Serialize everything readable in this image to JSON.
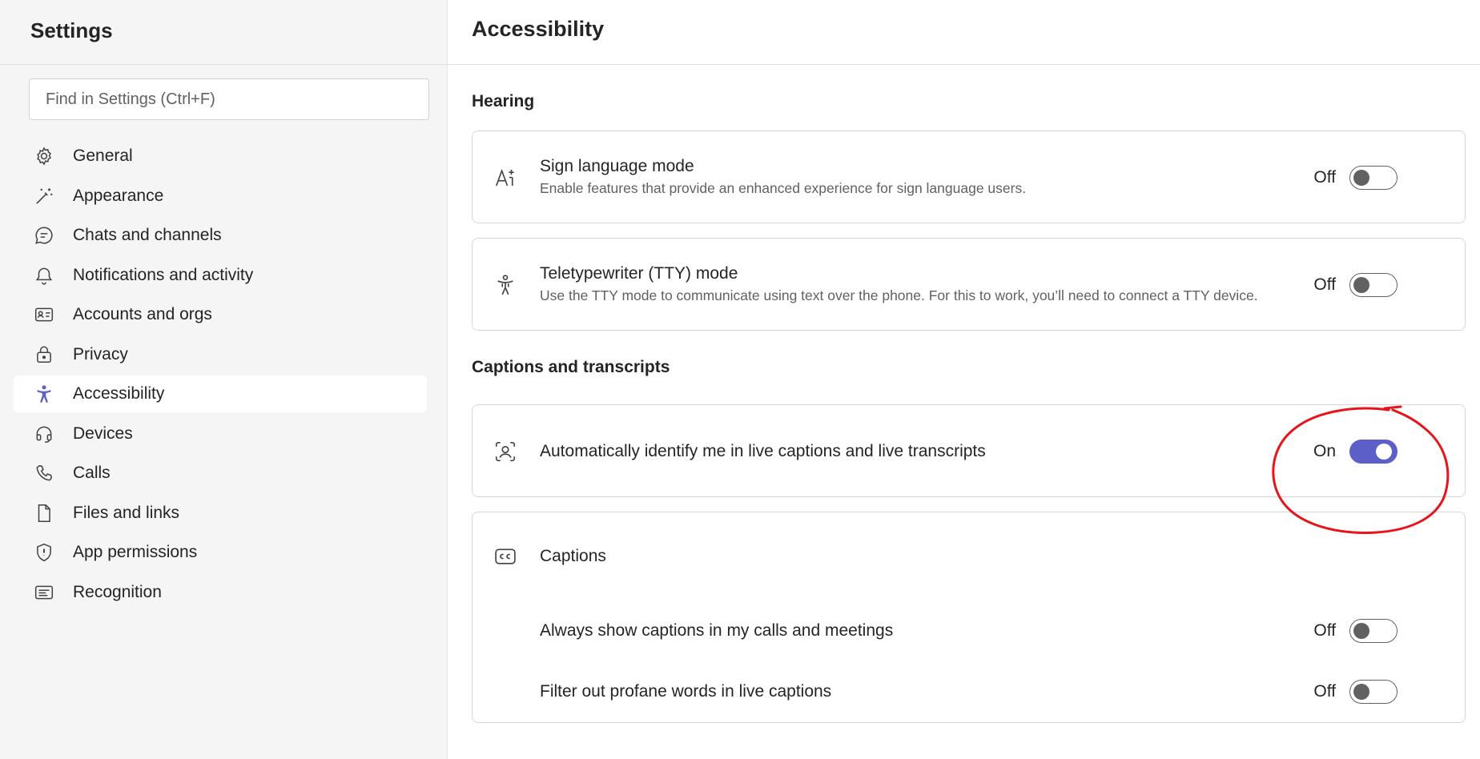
{
  "sidebar": {
    "title": "Settings",
    "search_placeholder": "Find in Settings (Ctrl+F)",
    "items": [
      {
        "label": "General",
        "icon": "gear-icon"
      },
      {
        "label": "Appearance",
        "icon": "magic-wand-icon"
      },
      {
        "label": "Chats and channels",
        "icon": "chat-bubble-icon"
      },
      {
        "label": "Notifications and activity",
        "icon": "bell-icon"
      },
      {
        "label": "Accounts and orgs",
        "icon": "contact-card-icon"
      },
      {
        "label": "Privacy",
        "icon": "lock-icon"
      },
      {
        "label": "Accessibility",
        "icon": "accessibility-icon",
        "active": true
      },
      {
        "label": "Devices",
        "icon": "headset-icon"
      },
      {
        "label": "Calls",
        "icon": "phone-icon"
      },
      {
        "label": "Files and links",
        "icon": "document-icon"
      },
      {
        "label": "App permissions",
        "icon": "shield-icon"
      },
      {
        "label": "Recognition",
        "icon": "text-box-icon"
      }
    ]
  },
  "main": {
    "title": "Accessibility",
    "hearing": {
      "heading": "Hearing",
      "sign_language": {
        "title": "Sign language mode",
        "description": "Enable features that provide an enhanced experience for sign language users.",
        "state": "Off",
        "icon": "sign-language-icon"
      },
      "tty": {
        "title": "Teletypewriter (TTY) mode",
        "description": "Use the TTY mode to communicate using text over the phone. For this to work, you’ll need to connect a TTY device.",
        "state": "Off",
        "icon": "accessibility-person-icon"
      }
    },
    "captions_transcripts": {
      "heading": "Captions and transcripts",
      "auto_identify": {
        "title": "Automatically identify me in live captions and live transcripts",
        "state": "On",
        "icon": "person-scan-icon"
      },
      "captions": {
        "title": "Captions",
        "icon": "closed-captions-icon",
        "always_show": {
          "title": "Always show captions in my calls and meetings",
          "state": "Off"
        },
        "filter_profane": {
          "title": "Filter out profane words in live captions",
          "state": "Off"
        }
      }
    }
  },
  "colors": {
    "accent": "#5b5fc7",
    "annotation": "#e8141c"
  }
}
